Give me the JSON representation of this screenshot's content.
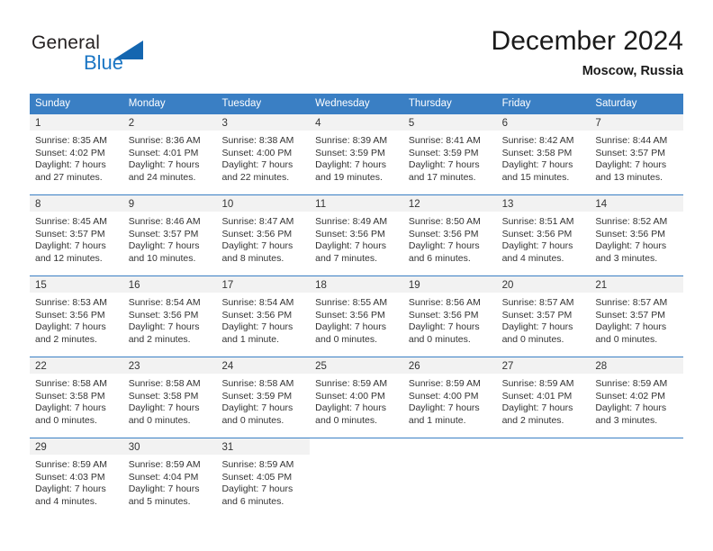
{
  "brand": {
    "name_part1": "General",
    "name_part2": "Blue",
    "triangle_color": "#1466b0",
    "blue_color": "#1b76c4"
  },
  "header": {
    "title": "December 2024",
    "subtitle": "Moscow, Russia"
  },
  "theme": {
    "header_bar_color": "#3a7fc4",
    "day_band_color": "#f2f2f2",
    "text_color": "#333333"
  },
  "weekdays": [
    "Sunday",
    "Monday",
    "Tuesday",
    "Wednesday",
    "Thursday",
    "Friday",
    "Saturday"
  ],
  "weeks": [
    [
      {
        "day": "1",
        "sunrise": "Sunrise: 8:35 AM",
        "sunset": "Sunset: 4:02 PM",
        "daylight": "Daylight: 7 hours and 27 minutes."
      },
      {
        "day": "2",
        "sunrise": "Sunrise: 8:36 AM",
        "sunset": "Sunset: 4:01 PM",
        "daylight": "Daylight: 7 hours and 24 minutes."
      },
      {
        "day": "3",
        "sunrise": "Sunrise: 8:38 AM",
        "sunset": "Sunset: 4:00 PM",
        "daylight": "Daylight: 7 hours and 22 minutes."
      },
      {
        "day": "4",
        "sunrise": "Sunrise: 8:39 AM",
        "sunset": "Sunset: 3:59 PM",
        "daylight": "Daylight: 7 hours and 19 minutes."
      },
      {
        "day": "5",
        "sunrise": "Sunrise: 8:41 AM",
        "sunset": "Sunset: 3:59 PM",
        "daylight": "Daylight: 7 hours and 17 minutes."
      },
      {
        "day": "6",
        "sunrise": "Sunrise: 8:42 AM",
        "sunset": "Sunset: 3:58 PM",
        "daylight": "Daylight: 7 hours and 15 minutes."
      },
      {
        "day": "7",
        "sunrise": "Sunrise: 8:44 AM",
        "sunset": "Sunset: 3:57 PM",
        "daylight": "Daylight: 7 hours and 13 minutes."
      }
    ],
    [
      {
        "day": "8",
        "sunrise": "Sunrise: 8:45 AM",
        "sunset": "Sunset: 3:57 PM",
        "daylight": "Daylight: 7 hours and 12 minutes."
      },
      {
        "day": "9",
        "sunrise": "Sunrise: 8:46 AM",
        "sunset": "Sunset: 3:57 PM",
        "daylight": "Daylight: 7 hours and 10 minutes."
      },
      {
        "day": "10",
        "sunrise": "Sunrise: 8:47 AM",
        "sunset": "Sunset: 3:56 PM",
        "daylight": "Daylight: 7 hours and 8 minutes."
      },
      {
        "day": "11",
        "sunrise": "Sunrise: 8:49 AM",
        "sunset": "Sunset: 3:56 PM",
        "daylight": "Daylight: 7 hours and 7 minutes."
      },
      {
        "day": "12",
        "sunrise": "Sunrise: 8:50 AM",
        "sunset": "Sunset: 3:56 PM",
        "daylight": "Daylight: 7 hours and 6 minutes."
      },
      {
        "day": "13",
        "sunrise": "Sunrise: 8:51 AM",
        "sunset": "Sunset: 3:56 PM",
        "daylight": "Daylight: 7 hours and 4 minutes."
      },
      {
        "day": "14",
        "sunrise": "Sunrise: 8:52 AM",
        "sunset": "Sunset: 3:56 PM",
        "daylight": "Daylight: 7 hours and 3 minutes."
      }
    ],
    [
      {
        "day": "15",
        "sunrise": "Sunrise: 8:53 AM",
        "sunset": "Sunset: 3:56 PM",
        "daylight": "Daylight: 7 hours and 2 minutes."
      },
      {
        "day": "16",
        "sunrise": "Sunrise: 8:54 AM",
        "sunset": "Sunset: 3:56 PM",
        "daylight": "Daylight: 7 hours and 2 minutes."
      },
      {
        "day": "17",
        "sunrise": "Sunrise: 8:54 AM",
        "sunset": "Sunset: 3:56 PM",
        "daylight": "Daylight: 7 hours and 1 minute."
      },
      {
        "day": "18",
        "sunrise": "Sunrise: 8:55 AM",
        "sunset": "Sunset: 3:56 PM",
        "daylight": "Daylight: 7 hours and 0 minutes."
      },
      {
        "day": "19",
        "sunrise": "Sunrise: 8:56 AM",
        "sunset": "Sunset: 3:56 PM",
        "daylight": "Daylight: 7 hours and 0 minutes."
      },
      {
        "day": "20",
        "sunrise": "Sunrise: 8:57 AM",
        "sunset": "Sunset: 3:57 PM",
        "daylight": "Daylight: 7 hours and 0 minutes."
      },
      {
        "day": "21",
        "sunrise": "Sunrise: 8:57 AM",
        "sunset": "Sunset: 3:57 PM",
        "daylight": "Daylight: 7 hours and 0 minutes."
      }
    ],
    [
      {
        "day": "22",
        "sunrise": "Sunrise: 8:58 AM",
        "sunset": "Sunset: 3:58 PM",
        "daylight": "Daylight: 7 hours and 0 minutes."
      },
      {
        "day": "23",
        "sunrise": "Sunrise: 8:58 AM",
        "sunset": "Sunset: 3:58 PM",
        "daylight": "Daylight: 7 hours and 0 minutes."
      },
      {
        "day": "24",
        "sunrise": "Sunrise: 8:58 AM",
        "sunset": "Sunset: 3:59 PM",
        "daylight": "Daylight: 7 hours and 0 minutes."
      },
      {
        "day": "25",
        "sunrise": "Sunrise: 8:59 AM",
        "sunset": "Sunset: 4:00 PM",
        "daylight": "Daylight: 7 hours and 0 minutes."
      },
      {
        "day": "26",
        "sunrise": "Sunrise: 8:59 AM",
        "sunset": "Sunset: 4:00 PM",
        "daylight": "Daylight: 7 hours and 1 minute."
      },
      {
        "day": "27",
        "sunrise": "Sunrise: 8:59 AM",
        "sunset": "Sunset: 4:01 PM",
        "daylight": "Daylight: 7 hours and 2 minutes."
      },
      {
        "day": "28",
        "sunrise": "Sunrise: 8:59 AM",
        "sunset": "Sunset: 4:02 PM",
        "daylight": "Daylight: 7 hours and 3 minutes."
      }
    ],
    [
      {
        "day": "29",
        "sunrise": "Sunrise: 8:59 AM",
        "sunset": "Sunset: 4:03 PM",
        "daylight": "Daylight: 7 hours and 4 minutes."
      },
      {
        "day": "30",
        "sunrise": "Sunrise: 8:59 AM",
        "sunset": "Sunset: 4:04 PM",
        "daylight": "Daylight: 7 hours and 5 minutes."
      },
      {
        "day": "31",
        "sunrise": "Sunrise: 8:59 AM",
        "sunset": "Sunset: 4:05 PM",
        "daylight": "Daylight: 7 hours and 6 minutes."
      },
      {
        "day": "",
        "sunrise": "",
        "sunset": "",
        "daylight": ""
      },
      {
        "day": "",
        "sunrise": "",
        "sunset": "",
        "daylight": ""
      },
      {
        "day": "",
        "sunrise": "",
        "sunset": "",
        "daylight": ""
      },
      {
        "day": "",
        "sunrise": "",
        "sunset": "",
        "daylight": ""
      }
    ]
  ]
}
